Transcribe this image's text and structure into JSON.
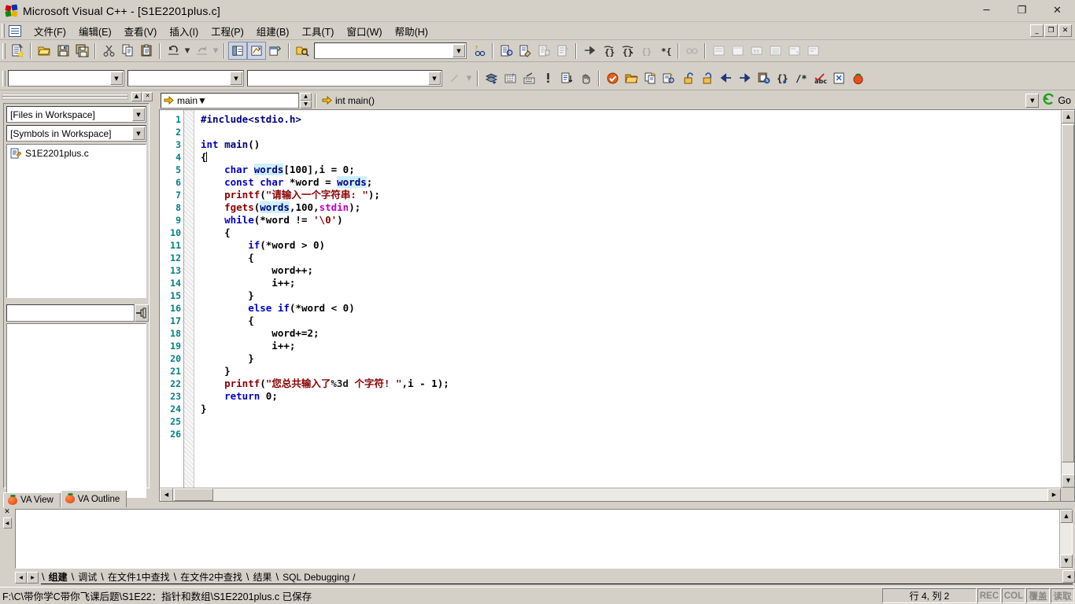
{
  "window": {
    "title": "Microsoft Visual C++ - [S1E2201plus.c]",
    "minimize": "─",
    "restore": "❐",
    "close": "✕"
  },
  "menubar": {
    "items": [
      {
        "label": "文件(F)",
        "name": "file"
      },
      {
        "label": "编辑(E)",
        "name": "edit"
      },
      {
        "label": "查看(V)",
        "name": "view"
      },
      {
        "label": "插入(I)",
        "name": "insert"
      },
      {
        "label": "工程(P)",
        "name": "project"
      },
      {
        "label": "组建(B)",
        "name": "build"
      },
      {
        "label": "工具(T)",
        "name": "tools"
      },
      {
        "label": "窗口(W)",
        "name": "window"
      },
      {
        "label": "帮助(H)",
        "name": "help"
      }
    ],
    "mdi": {
      "minimize": "_",
      "restore": "❐",
      "close": "✕"
    }
  },
  "toolbar_find": {
    "value": "",
    "placeholder": ""
  },
  "toolbar2": {
    "combo1": "",
    "combo2": "",
    "combo3": ""
  },
  "workspace": {
    "files_combo": "[Files in Workspace]",
    "symbols_combo": "[Symbols in Workspace]",
    "tree": [
      {
        "label": "S1E2201plus.c"
      }
    ],
    "find_value": "",
    "find_placeholder": "",
    "tabs": [
      {
        "label": "VA View",
        "active": false
      },
      {
        "label": "VA Outline",
        "active": true
      }
    ]
  },
  "navbar": {
    "scope": "main",
    "signature": "int main()",
    "go_label": "Go"
  },
  "editor": {
    "first_line": 1,
    "last_line": 26,
    "lines": [
      {
        "n": 1,
        "html": "<span class=\"pp\">#include&lt;stdio.h&gt;</span>"
      },
      {
        "n": 2,
        "html": ""
      },
      {
        "n": 3,
        "html": "<span class=\"kw\">int</span> <span class=\"id\">main</span>()"
      },
      {
        "n": 4,
        "html": "{<span class=\"caret\"></span>"
      },
      {
        "n": 5,
        "html": "    <span class=\"kw\">char</span> <span class=\"hl id\">words</span>[<span class=\"num\">100</span>],i = <span class=\"num\">0</span>;"
      },
      {
        "n": 6,
        "html": "    <span class=\"kw\">const</span> <span class=\"kw\">char</span> *word = <span class=\"hl id\">words</span>;"
      },
      {
        "n": 7,
        "html": "    <span class=\"fn\">printf</span>(<span class=\"str\">\"请输入一个字符串: \"</span>);"
      },
      {
        "n": 8,
        "html": "    <span class=\"fn\">fgets</span>(<span class=\"hl id\">words</span>,<span class=\"num\">100</span>,<span class=\"mag\">stdin</span>);"
      },
      {
        "n": 9,
        "html": "    <span class=\"kw\">while</span>(*word != <span class=\"str\">'\\0'</span>)"
      },
      {
        "n": 10,
        "html": "    {"
      },
      {
        "n": 11,
        "html": "        <span class=\"kw\">if</span>(*word &gt; <span class=\"num\">0</span>)"
      },
      {
        "n": 12,
        "html": "        {"
      },
      {
        "n": 13,
        "html": "            word++;"
      },
      {
        "n": 14,
        "html": "            i++;"
      },
      {
        "n": 15,
        "html": "        }"
      },
      {
        "n": 16,
        "html": "        <span class=\"kw\">else</span> <span class=\"kw\">if</span>(*word &lt; <span class=\"num\">0</span>)"
      },
      {
        "n": 17,
        "html": "        {"
      },
      {
        "n": 18,
        "html": "            word+=<span class=\"num\">2</span>;"
      },
      {
        "n": 19,
        "html": "            i++;"
      },
      {
        "n": 20,
        "html": "        }"
      },
      {
        "n": 21,
        "html": "    }"
      },
      {
        "n": 22,
        "html": "    <span class=\"fn\">printf</span>(<span class=\"str\">\"您总共输入了</span><span class=\"fmt\">%3d</span><span class=\"str\"> 个字符! \"</span>,i - <span class=\"num\">1</span>);"
      },
      {
        "n": 23,
        "html": "    <span class=\"kw\">return</span> <span class=\"num\">0</span>;"
      },
      {
        "n": 24,
        "html": "}"
      },
      {
        "n": 25,
        "html": ""
      },
      {
        "n": 26,
        "html": ""
      }
    ],
    "plain_text": "#include<stdio.h>\n\nint main()\n{\n    char words[100],i = 0;\n    const char *word = words;\n    printf(\"请输入一个字符串: \");\n    fgets(words,100,stdin);\n    while(*word != '\\0')\n    {\n        if(*word > 0)\n        {\n            word++;\n            i++;\n        }\n        else if(*word < 0)\n        {\n            word+=2;\n            i++;\n        }\n    }\n    printf(\"您总共输入了%3d 个字符! \",i - 1);\n    return 0;\n}\n\n",
    "colors": {
      "keyword": "#0000cc",
      "string": "#8b0000",
      "identifier": "#000080",
      "linenumber": "#008080",
      "highlight": "#cdeffd",
      "macro": "#c000c0",
      "background": "#ffffff"
    }
  },
  "output": {
    "content": "",
    "tabs": [
      {
        "label": "组建",
        "active": true
      },
      {
        "label": "调试",
        "active": false
      },
      {
        "label": "在文件1中查找",
        "active": false
      },
      {
        "label": "在文件2中查找",
        "active": false
      },
      {
        "label": "结果",
        "active": false
      },
      {
        "label": "SQL Debugging",
        "active": false
      }
    ]
  },
  "statusbar": {
    "message": "F:\\C\\带你学C带你飞课后题\\S1E22：指针和数组\\S1E2201plus.c 已保存",
    "position": "行 4, 列 2",
    "indicators": [
      "REC",
      "COL",
      "覆盖",
      "读取"
    ]
  }
}
